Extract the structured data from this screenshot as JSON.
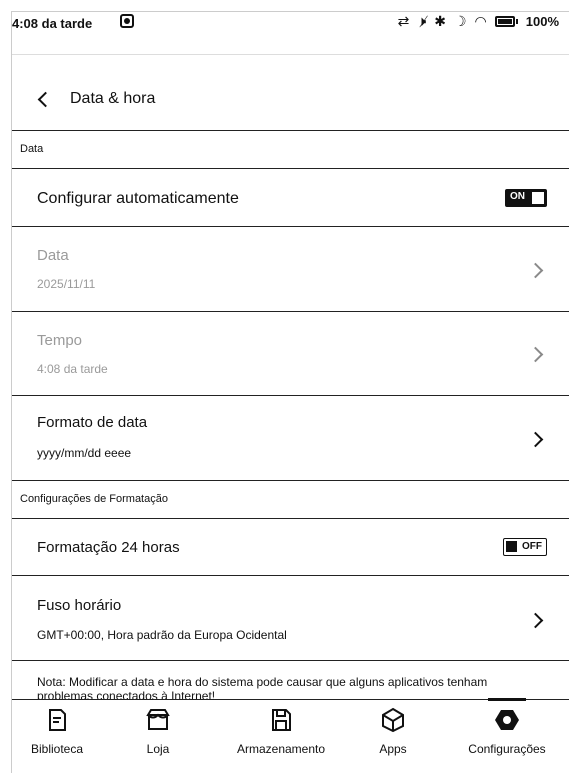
{
  "status": {
    "time": "4:08 da tarde",
    "battery": "100%",
    "icons": [
      "sync-icon",
      "mute-icon",
      "bluetooth-icon",
      "moon-icon",
      "wifi-icon",
      "battery-icon"
    ]
  },
  "header": {
    "title": "Data & hora"
  },
  "sections": {
    "data": "Data",
    "format": "Configurações de Formatação"
  },
  "items": {
    "auto": {
      "title": "Configurar automaticamente",
      "toggle": "ON"
    },
    "date": {
      "title": "Data",
      "value": "2025/11/11"
    },
    "time": {
      "title": "Tempo",
      "value": "4:08 da tarde"
    },
    "date_format": {
      "title": "Formato de data",
      "value": "yyyy/mm/dd eeee"
    },
    "hour24": {
      "title": "Formatação 24 horas",
      "toggle": "OFF"
    },
    "timezone": {
      "title": "Fuso horário",
      "value": "GMT+00:00, Hora padrão da Europa Ocidental"
    }
  },
  "note": "Nota: Modificar a data e hora do sistema pode causar que alguns aplicativos tenham problemas conectados à Internet!",
  "tabs": [
    {
      "label": "Biblioteca",
      "icon": "library-icon"
    },
    {
      "label": "Loja",
      "icon": "store-icon"
    },
    {
      "label": "Armazenamento",
      "icon": "storage-icon"
    },
    {
      "label": "Apps",
      "icon": "apps-icon"
    },
    {
      "label": "Configurações",
      "icon": "settings-icon",
      "active": true
    }
  ]
}
